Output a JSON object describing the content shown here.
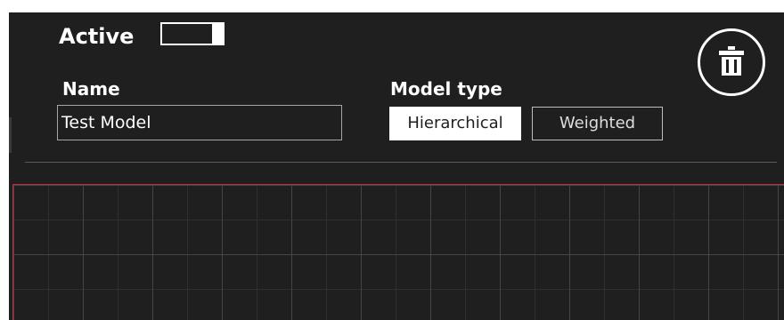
{
  "header": {
    "active_label": "Active",
    "active_toggle_on": true
  },
  "form": {
    "name_label": "Name",
    "name_value": "Test Model",
    "model_type_label": "Model type",
    "model_type_options": [
      "Hierarchical",
      "Weighted"
    ],
    "model_type_selected": "Hierarchical"
  },
  "actions": {
    "delete_icon": "trash-icon"
  },
  "colors": {
    "background": "#1f1f1f",
    "text": "#ffffff",
    "canvas_border": "#c42b3a",
    "grid_line": "#454545",
    "selected_segment": "#ffffff"
  }
}
